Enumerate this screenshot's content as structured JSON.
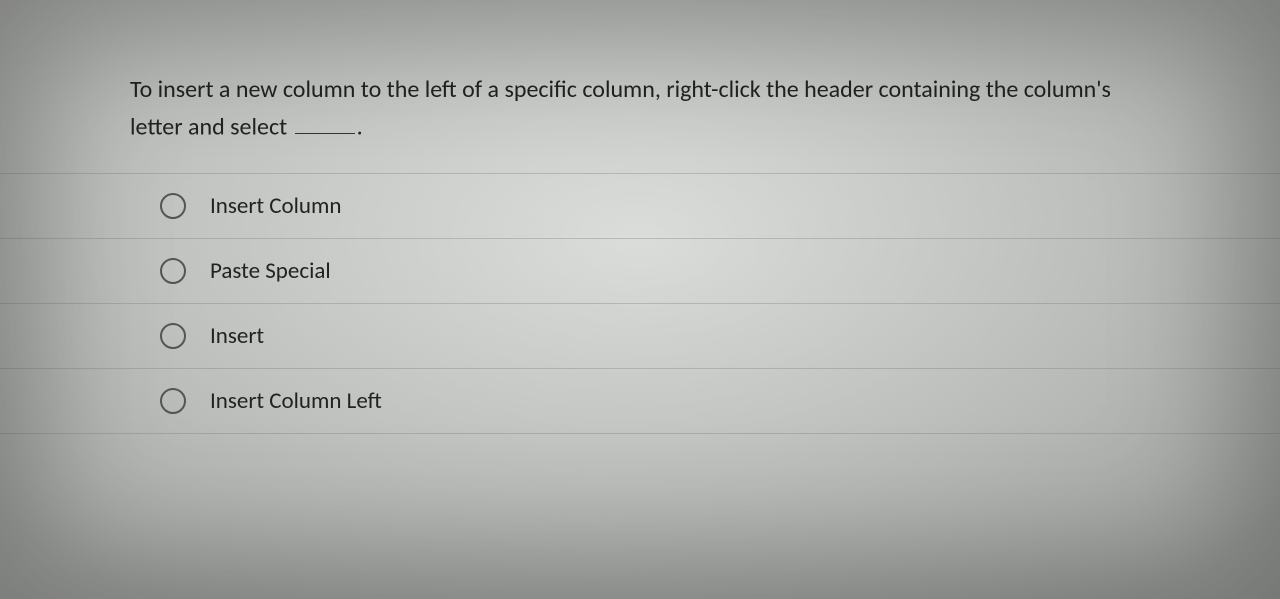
{
  "question": {
    "text_before_blank": "To insert a new column to the left of a specific column, right-click the header containing the column's letter and select ",
    "text_after_blank": "."
  },
  "options": [
    {
      "label": "Insert Column"
    },
    {
      "label": "Paste Special"
    },
    {
      "label": "Insert"
    },
    {
      "label": "Insert Column Left"
    }
  ]
}
